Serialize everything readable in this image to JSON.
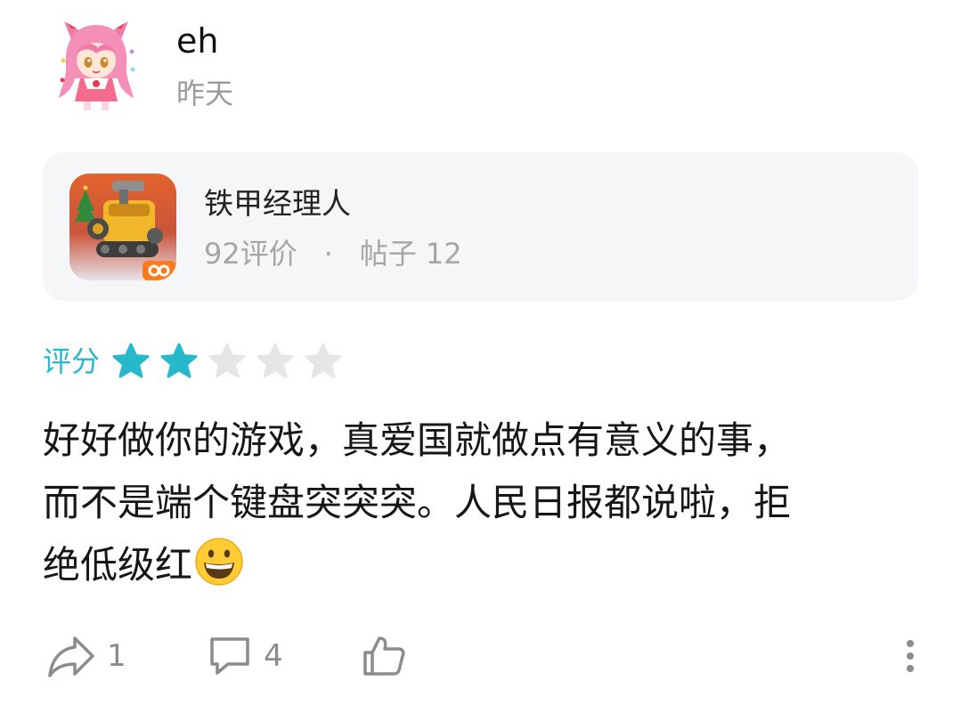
{
  "post": {
    "username": "eh",
    "time": "昨天"
  },
  "game": {
    "name": "铁甲经理人",
    "reviews": "92评价",
    "separator": "·",
    "posts_label": "帖子",
    "posts_count": "12"
  },
  "rating": {
    "label": "评分",
    "value": 2,
    "max": 5,
    "active_color": "#27b8cc",
    "inactive_color": "#e6e6e6"
  },
  "review": {
    "lines": [
      "好好做你的游戏，真爱国就做点有意义的事，",
      "而不是端个键盘突突突。人民日报都说啦，拒",
      "绝低级红"
    ],
    "emoji": "grinning-face"
  },
  "actions": {
    "share_count": "1",
    "comment_count": "4",
    "like_icon": "thumbs-up-icon",
    "more_icon": "more-vertical-icon"
  }
}
